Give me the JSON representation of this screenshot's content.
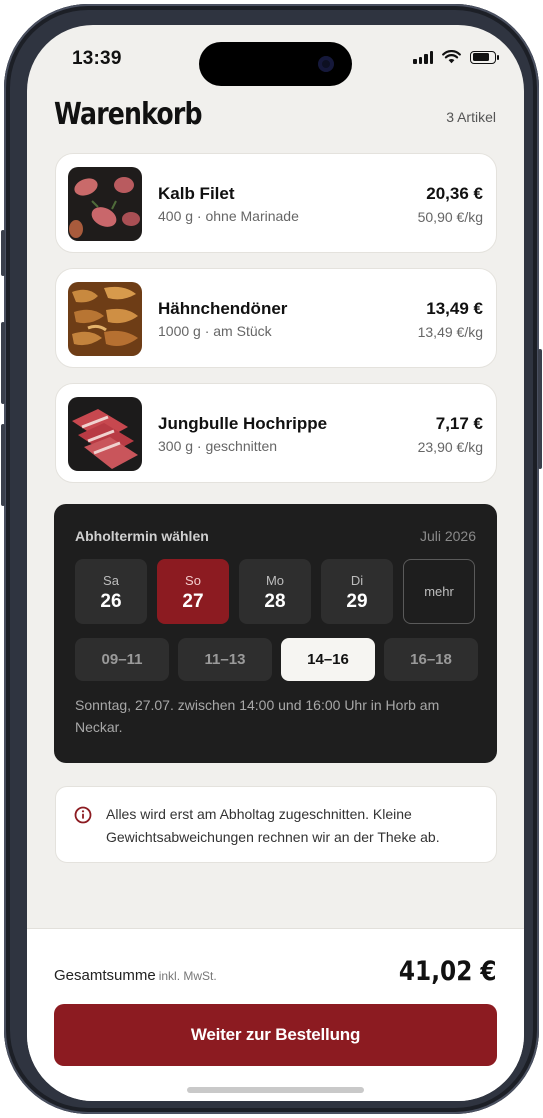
{
  "status_bar": {
    "time": "13:39"
  },
  "header": {
    "title": "Warenkorb",
    "item_count": "3 Artikel"
  },
  "cart": {
    "items": [
      {
        "name": "Kalb Filet",
        "meta": "400 g · ohne Marinade",
        "price": "20,36 €",
        "unit_price": "50,90 €/kg",
        "image": "veal-fillet-photo"
      },
      {
        "name": "Hähnchendöner",
        "meta": "1000 g · am Stück",
        "price": "13,49 €",
        "unit_price": "13,49 €/kg",
        "image": "chicken-doner-photo"
      },
      {
        "name": "Jungbulle Hochrippe",
        "meta": "300 g · geschnitten",
        "price": "7,17 €",
        "unit_price": "23,90 €/kg",
        "image": "beef-rib-photo"
      }
    ]
  },
  "pickup": {
    "title": "Abholtermin wählen",
    "month": "Juli 2026",
    "days": [
      {
        "dow": "Sa",
        "num": "26",
        "selected": false
      },
      {
        "dow": "So",
        "num": "27",
        "selected": true
      },
      {
        "dow": "Mo",
        "num": "28",
        "selected": false
      },
      {
        "dow": "Di",
        "num": "29",
        "selected": false
      }
    ],
    "more_label": "mehr",
    "slots": [
      {
        "label": "09–11",
        "selected": false
      },
      {
        "label": "11–13",
        "selected": false
      },
      {
        "label": "14–16",
        "selected": true
      },
      {
        "label": "16–18",
        "selected": false
      }
    ],
    "description": "Sonntag, 27.07. zwischen 14:00 und 16:00 Uhr in Horb am Neckar."
  },
  "info": {
    "icon": "info-icon",
    "text": "Alles wird erst am Abholtag zugeschnitten. Kleine Gewichtsabweichungen rechnen wir an der Theke ab."
  },
  "footer": {
    "total_label": "Gesamtsumme",
    "vat_label": "inkl. MwSt.",
    "total_value": "41,02 €",
    "cta_label": "Weiter zur Bestellung"
  },
  "colors": {
    "accent": "#8c1b21",
    "panel": "#1e1e1e",
    "background": "#f1f0ed"
  }
}
